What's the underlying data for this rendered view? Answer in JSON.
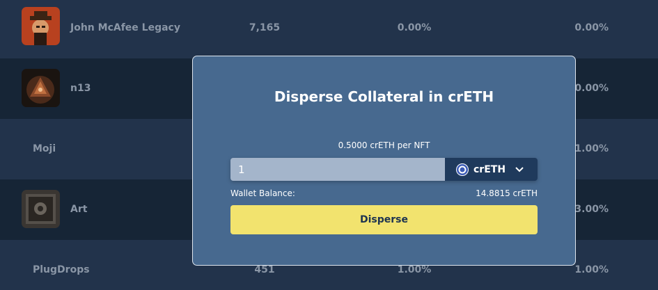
{
  "rows": [
    {
      "name": "John McAfee Legacy",
      "col1": "7,165",
      "col2": "0.00%",
      "col3": "0.00%"
    },
    {
      "name": "n13",
      "col1": "",
      "col2": "",
      "col3": "0.00%"
    },
    {
      "name": "Moji",
      "col1": "",
      "col2": "",
      "col3": "1.00%"
    },
    {
      "name": "Art",
      "col1": "",
      "col2": "",
      "col3": "3.00%"
    },
    {
      "name": "PlugDrops",
      "col1": "451",
      "col2": "1.00%",
      "col3": "1.00%"
    }
  ],
  "modal": {
    "title": "Disperse Collateral in crETH",
    "rate_text": "0.5000 crETH per NFT",
    "amount_value": "1",
    "token_label": "crETH",
    "wallet_balance_label": "Wallet Balance:",
    "wallet_balance_value": "14.8815 crETH",
    "disperse_label": "Disperse"
  },
  "icons": {
    "token": "creth-token-icon",
    "dropdown": "chevron-down-icon"
  },
  "colors": {
    "modal_bg": "#47698f",
    "button_bg": "#f2e36e",
    "row_light": "#22334b",
    "row_dark": "#162536"
  }
}
